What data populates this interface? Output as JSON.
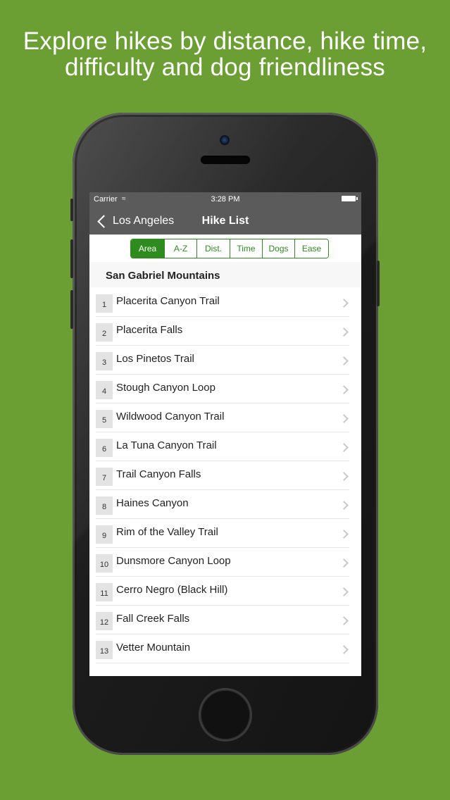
{
  "headline": {
    "line1": "Explore hikes by distance, hike time,",
    "line2": "difficulty and dog friendliness"
  },
  "status_bar": {
    "carrier": "Carrier",
    "wifi_icon": "wifi-icon",
    "time": "3:28 PM",
    "battery_icon": "battery-icon"
  },
  "nav": {
    "back_label": "Los Angeles",
    "title": "Hike List"
  },
  "sort_segments": [
    {
      "label": "Area",
      "selected": true
    },
    {
      "label": "A-Z",
      "selected": false
    },
    {
      "label": "Dist.",
      "selected": false
    },
    {
      "label": "Time",
      "selected": false
    },
    {
      "label": "Dogs",
      "selected": false
    },
    {
      "label": "Ease",
      "selected": false
    }
  ],
  "section_header": "San Gabriel Mountains",
  "hikes": [
    {
      "num": "1",
      "name": "Placerita Canyon Trail"
    },
    {
      "num": "2",
      "name": "Placerita Falls"
    },
    {
      "num": "3",
      "name": "Los Pinetos Trail"
    },
    {
      "num": "4",
      "name": "Stough Canyon Loop"
    },
    {
      "num": "5",
      "name": "Wildwood Canyon Trail"
    },
    {
      "num": "6",
      "name": "La Tuna Canyon Trail"
    },
    {
      "num": "7",
      "name": "Trail Canyon Falls"
    },
    {
      "num": "8",
      "name": "Haines Canyon"
    },
    {
      "num": "9",
      "name": "Rim of the Valley Trail"
    },
    {
      "num": "10",
      "name": "Dunsmore Canyon Loop"
    },
    {
      "num": "11",
      "name": "Cerro Negro (Black Hill)"
    },
    {
      "num": "12",
      "name": "Fall Creek Falls"
    },
    {
      "num": "13",
      "name": "Vetter Mountain"
    }
  ],
  "colors": {
    "background": "#6c9f33",
    "accent": "#2e8b1e",
    "nav_bar": "#5b5b5b"
  }
}
